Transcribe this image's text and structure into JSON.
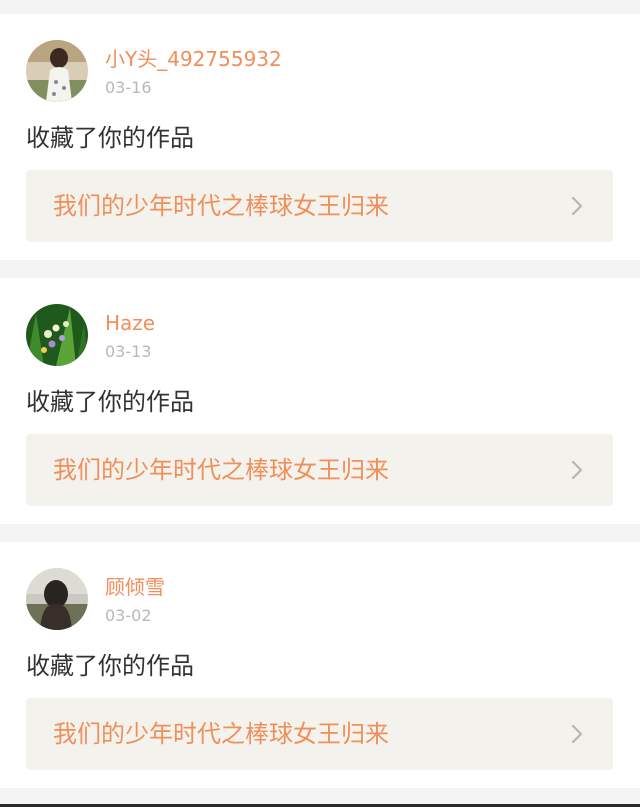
{
  "feed": [
    {
      "username": "小Y头_492755932",
      "date": "03-16",
      "action": "收藏了你的作品",
      "work_title": "我们的少年时代之棒球女王归来"
    },
    {
      "username": "Haze",
      "date": "03-13",
      "action": "收藏了你的作品",
      "work_title": "我们的少年时代之棒球女王归来"
    },
    {
      "username": "顾倾雪",
      "date": "03-02",
      "action": "收藏了你的作品",
      "work_title": "我们的少年时代之棒球女王归来"
    }
  ],
  "icons": {
    "chevron": "chevron-right-icon",
    "avatar": "user-avatar"
  },
  "colors": {
    "accent": "#f08f5a",
    "date": "#b8b8b8",
    "text": "#333333",
    "link_bg": "#f3f2ec",
    "page_bg": "#f4f4f4"
  }
}
